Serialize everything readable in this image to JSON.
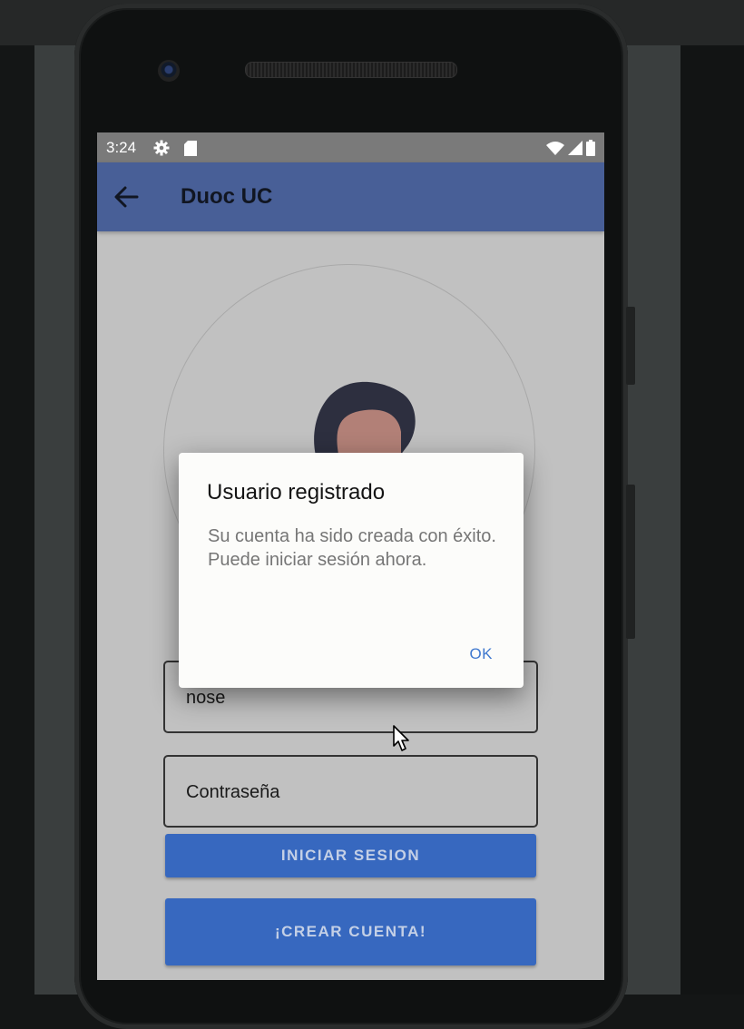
{
  "status_bar": {
    "time": "3:24"
  },
  "app_bar": {
    "title": "Duoc UC"
  },
  "form": {
    "user_value": "nose",
    "password_placeholder": "Contraseña",
    "login_button": "INICIAR SESION",
    "create_button": "¡CREAR CUENTA!"
  },
  "dialog": {
    "title": "Usuario registrado",
    "message": "Su cuenta ha sido creada con éxito. Puede iniciar sesión ahora.",
    "ok_label": "OK"
  },
  "colors": {
    "app_bar": "#485f97",
    "button": "#3768bf",
    "ok_accent": "#3f78cf",
    "screen_scrim": "#c1c1c1"
  }
}
